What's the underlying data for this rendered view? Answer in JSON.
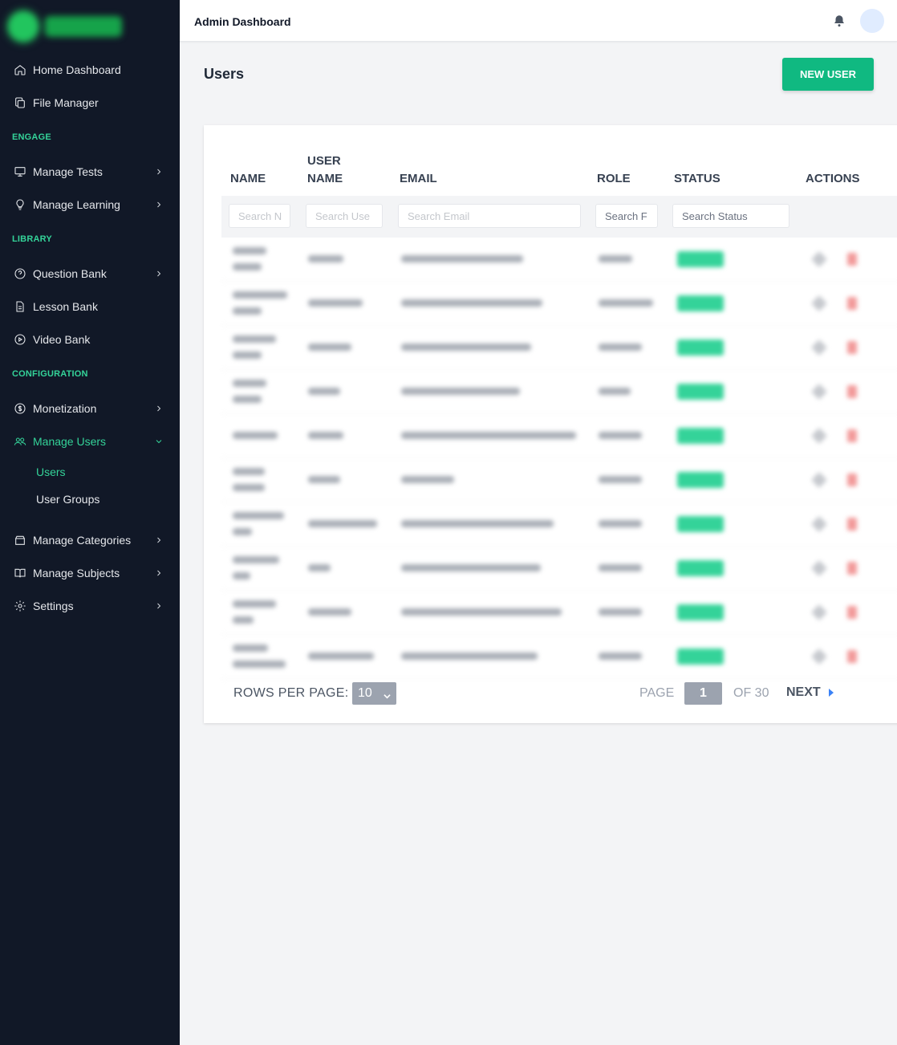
{
  "sidebar": {
    "items": [
      {
        "label": "Home Dashboard"
      },
      {
        "label": "File Manager"
      },
      {
        "label": "Manage Tests"
      },
      {
        "label": "Manage Learning"
      },
      {
        "label": "Question Bank"
      },
      {
        "label": "Lesson Bank"
      },
      {
        "label": "Video Bank"
      },
      {
        "label": "Monetization"
      },
      {
        "label": "Manage Users"
      },
      {
        "label": "Manage Categories"
      },
      {
        "label": "Manage Subjects"
      },
      {
        "label": "Settings"
      }
    ],
    "sections": {
      "engage": "ENGAGE",
      "library": "LIBRARY",
      "configuration": "CONFIGURATION"
    },
    "sub_items": {
      "users": "Users",
      "user_groups": "User Groups"
    },
    "icons": [
      "home-icon",
      "copy-icon",
      "monitor-icon",
      "lightbulb-icon",
      "question-circle-icon",
      "document-icon",
      "play-circle-icon",
      "dollar-circle-icon",
      "users-icon",
      "archive-icon",
      "book-open-icon",
      "gear-icon"
    ],
    "accent_color": "#34d399",
    "background": "#111827"
  },
  "header": {
    "title": "Admin Dashboard"
  },
  "main": {
    "title": "Users",
    "new_user_label": "NEW USER",
    "brand_color": "#10b981"
  },
  "table": {
    "columns": {
      "name": "NAME",
      "username_line1": "USER",
      "username_line2": "NAME",
      "email": "EMAIL",
      "role": "ROLE",
      "status": "STATUS",
      "actions": "ACTIONS"
    },
    "filters": {
      "name": "Search N",
      "username": "Search Use",
      "email": "Search Email",
      "role": "Search F",
      "status": "Search Status"
    }
  },
  "pagination": {
    "rows_per_page_label": "ROWS PER PAGE:",
    "rows_per_page_value": "10",
    "page_label": "PAGE",
    "current_page": "1",
    "of_label": "OF 30",
    "next_label": "NEXT"
  }
}
